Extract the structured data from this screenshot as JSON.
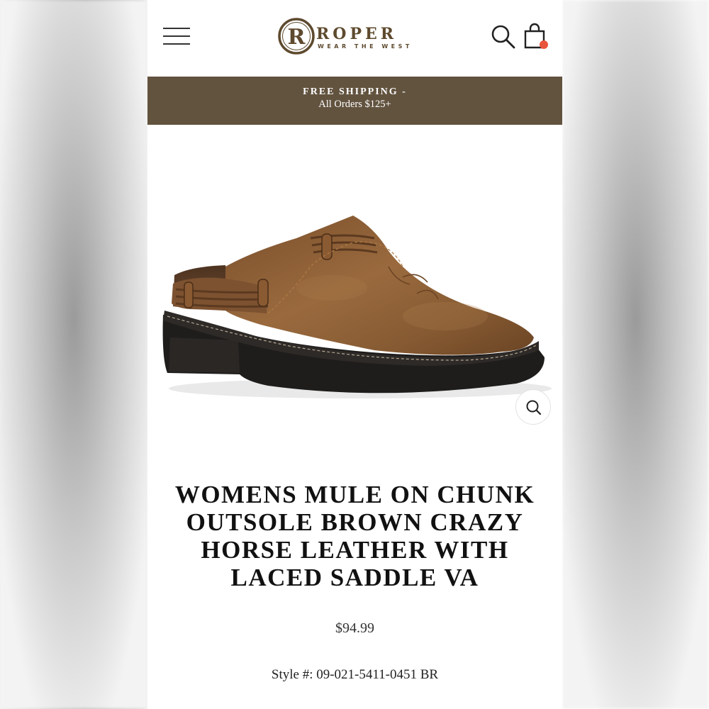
{
  "brand": {
    "logo_letter": "R",
    "name": "ROPER",
    "tagline": "WEAR THE WEST"
  },
  "header": {
    "icons": [
      "menu-icon",
      "search-icon",
      "shopping-bag-icon"
    ]
  },
  "banner": {
    "line1": "FREE SHIPPING -",
    "line2": "All Orders $125+"
  },
  "product": {
    "title": "WOMENS MULE ON CHUNK OUTSOLE BROWN CRAZY HORSE LEATHER WITH LACED SADDLE VA",
    "price": "$94.99",
    "style_number": "Style #: 09-021-5411-0451 BR"
  },
  "colors": {
    "brand_brown": "#62533f",
    "logo_brown": "#5e4a2e",
    "cart_badge": "#e8553a",
    "leather": "#8a5a30"
  }
}
